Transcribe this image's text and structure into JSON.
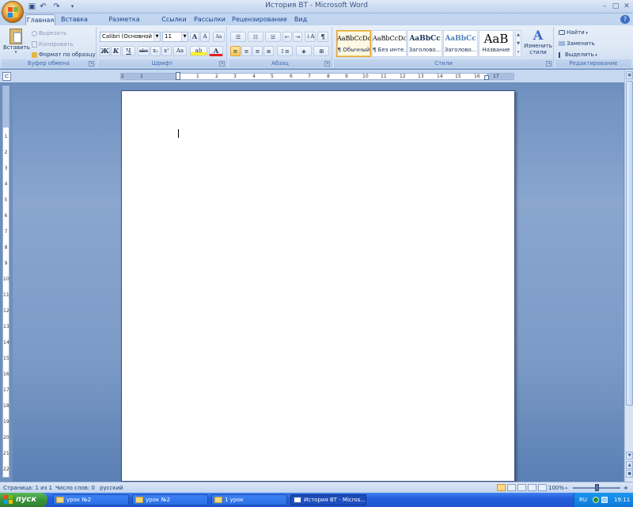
{
  "window": {
    "title": "История ВТ - Microsoft Word",
    "minimize": "–",
    "maximize": "□",
    "close": "✕"
  },
  "quick_access": [
    {
      "name": "save-icon",
      "glyph": "▣"
    },
    {
      "name": "undo-icon",
      "glyph": "↶"
    },
    {
      "name": "redo-icon",
      "glyph": "↷"
    },
    {
      "name": "customize-icon",
      "glyph": "▾"
    }
  ],
  "tabs": [
    {
      "label": "Главная",
      "active": true
    },
    {
      "label": "Вставка"
    },
    {
      "label": "Разметка страницы"
    },
    {
      "label": "Ссылки"
    },
    {
      "label": "Рассылки"
    },
    {
      "label": "Рецензирование"
    },
    {
      "label": "Вид"
    }
  ],
  "help_icon": "?",
  "ribbon": {
    "clipboard": {
      "label": "Буфер обмена",
      "paste": "Вставить",
      "cut": "Вырезать",
      "copy": "Копировать",
      "format_painter": "Формат по образцу"
    },
    "font": {
      "label": "Шрифт",
      "family": "Calibri (Основной те",
      "size": "11",
      "grow": "A",
      "shrink": "A",
      "clear": "Aa",
      "bold": "Ж",
      "italic": "К",
      "underline": "Ч",
      "strike": "abe",
      "subscript": "x₂",
      "superscript": "x²",
      "case": "Aa",
      "highlight": "ab",
      "font_color": "A"
    },
    "paragraph": {
      "label": "Абзац",
      "show_marks": "¶",
      "sort": "↓A"
    },
    "styles": {
      "label": "Стили",
      "items": [
        {
          "sample": "AaBbCcDc",
          "name": "¶ Обычный",
          "selected": true
        },
        {
          "sample": "AaBbCcDc",
          "name": "¶ Без инте..."
        },
        {
          "sample": "AaBbCc",
          "name": "Заголово..."
        },
        {
          "sample": "AaBbCc",
          "name": "Заголово..."
        },
        {
          "sample": "AaB",
          "name": "Название"
        }
      ],
      "change_styles": "Изменить стили"
    },
    "editing": {
      "label": "Редактирование",
      "find": "Найти",
      "replace": "Заменить",
      "select": "Выделить"
    }
  },
  "ruler": {
    "toggle": "⊏",
    "marks": [
      "2",
      "1",
      "1",
      "2",
      "3",
      "4",
      "5",
      "6",
      "7",
      "8",
      "9",
      "10",
      "11",
      "12",
      "13",
      "14",
      "15",
      "16",
      "17"
    ],
    "vmarks": [
      "1",
      "2",
      "3",
      "4",
      "5",
      "6",
      "7",
      "8",
      "9",
      "10",
      "11",
      "12",
      "13",
      "14",
      "15",
      "16",
      "17",
      "18",
      "19",
      "20",
      "21",
      "22"
    ]
  },
  "status": {
    "page": "Страница: 1 из 1",
    "words": "Число слов: 0",
    "language": "русский",
    "zoom": "100%",
    "zoom_minus": "–",
    "zoom_plus": "+"
  },
  "taskbar": {
    "start": "пуск",
    "buttons": [
      {
        "label": "урок №2"
      },
      {
        "label": "урок №2"
      },
      {
        "label": "1 урок"
      },
      {
        "label": "История ВТ - Micros...",
        "active": true
      }
    ],
    "lang": "RU",
    "time": "19:11"
  }
}
